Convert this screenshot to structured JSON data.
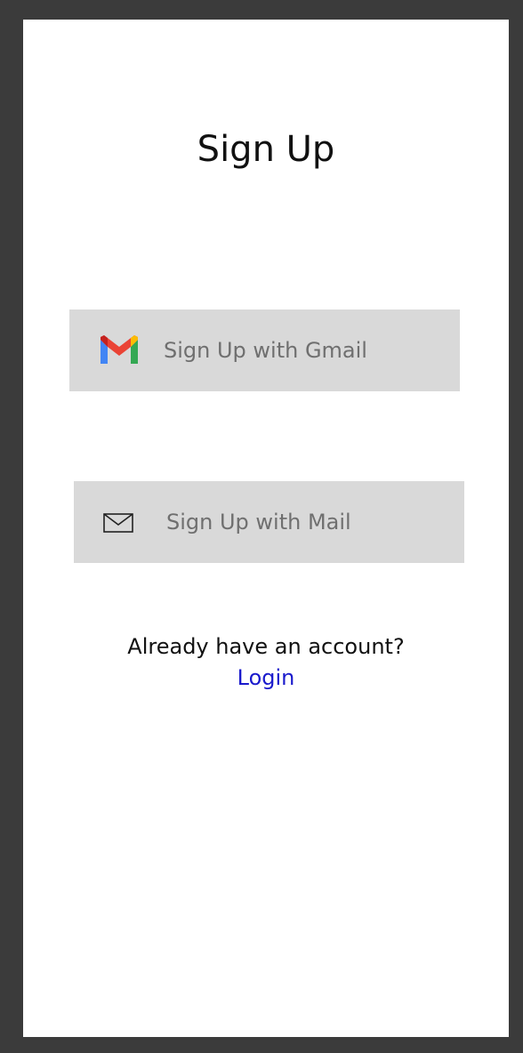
{
  "page": {
    "title": "Sign Up"
  },
  "buttons": {
    "gmail": {
      "label": "Sign Up with Gmail",
      "icon": "gmail-icon"
    },
    "mail": {
      "label": "Sign Up with Mail",
      "icon": "envelope-icon"
    }
  },
  "account": {
    "prompt": "Already have an account?",
    "login_label": "Login"
  },
  "colors": {
    "button_bg": "#d9d9d9",
    "link": "#1a1acc",
    "gmail_red": "#ea4335",
    "gmail_blue": "#4285f4",
    "gmail_green": "#34a853",
    "gmail_yellow": "#fbbc04"
  }
}
